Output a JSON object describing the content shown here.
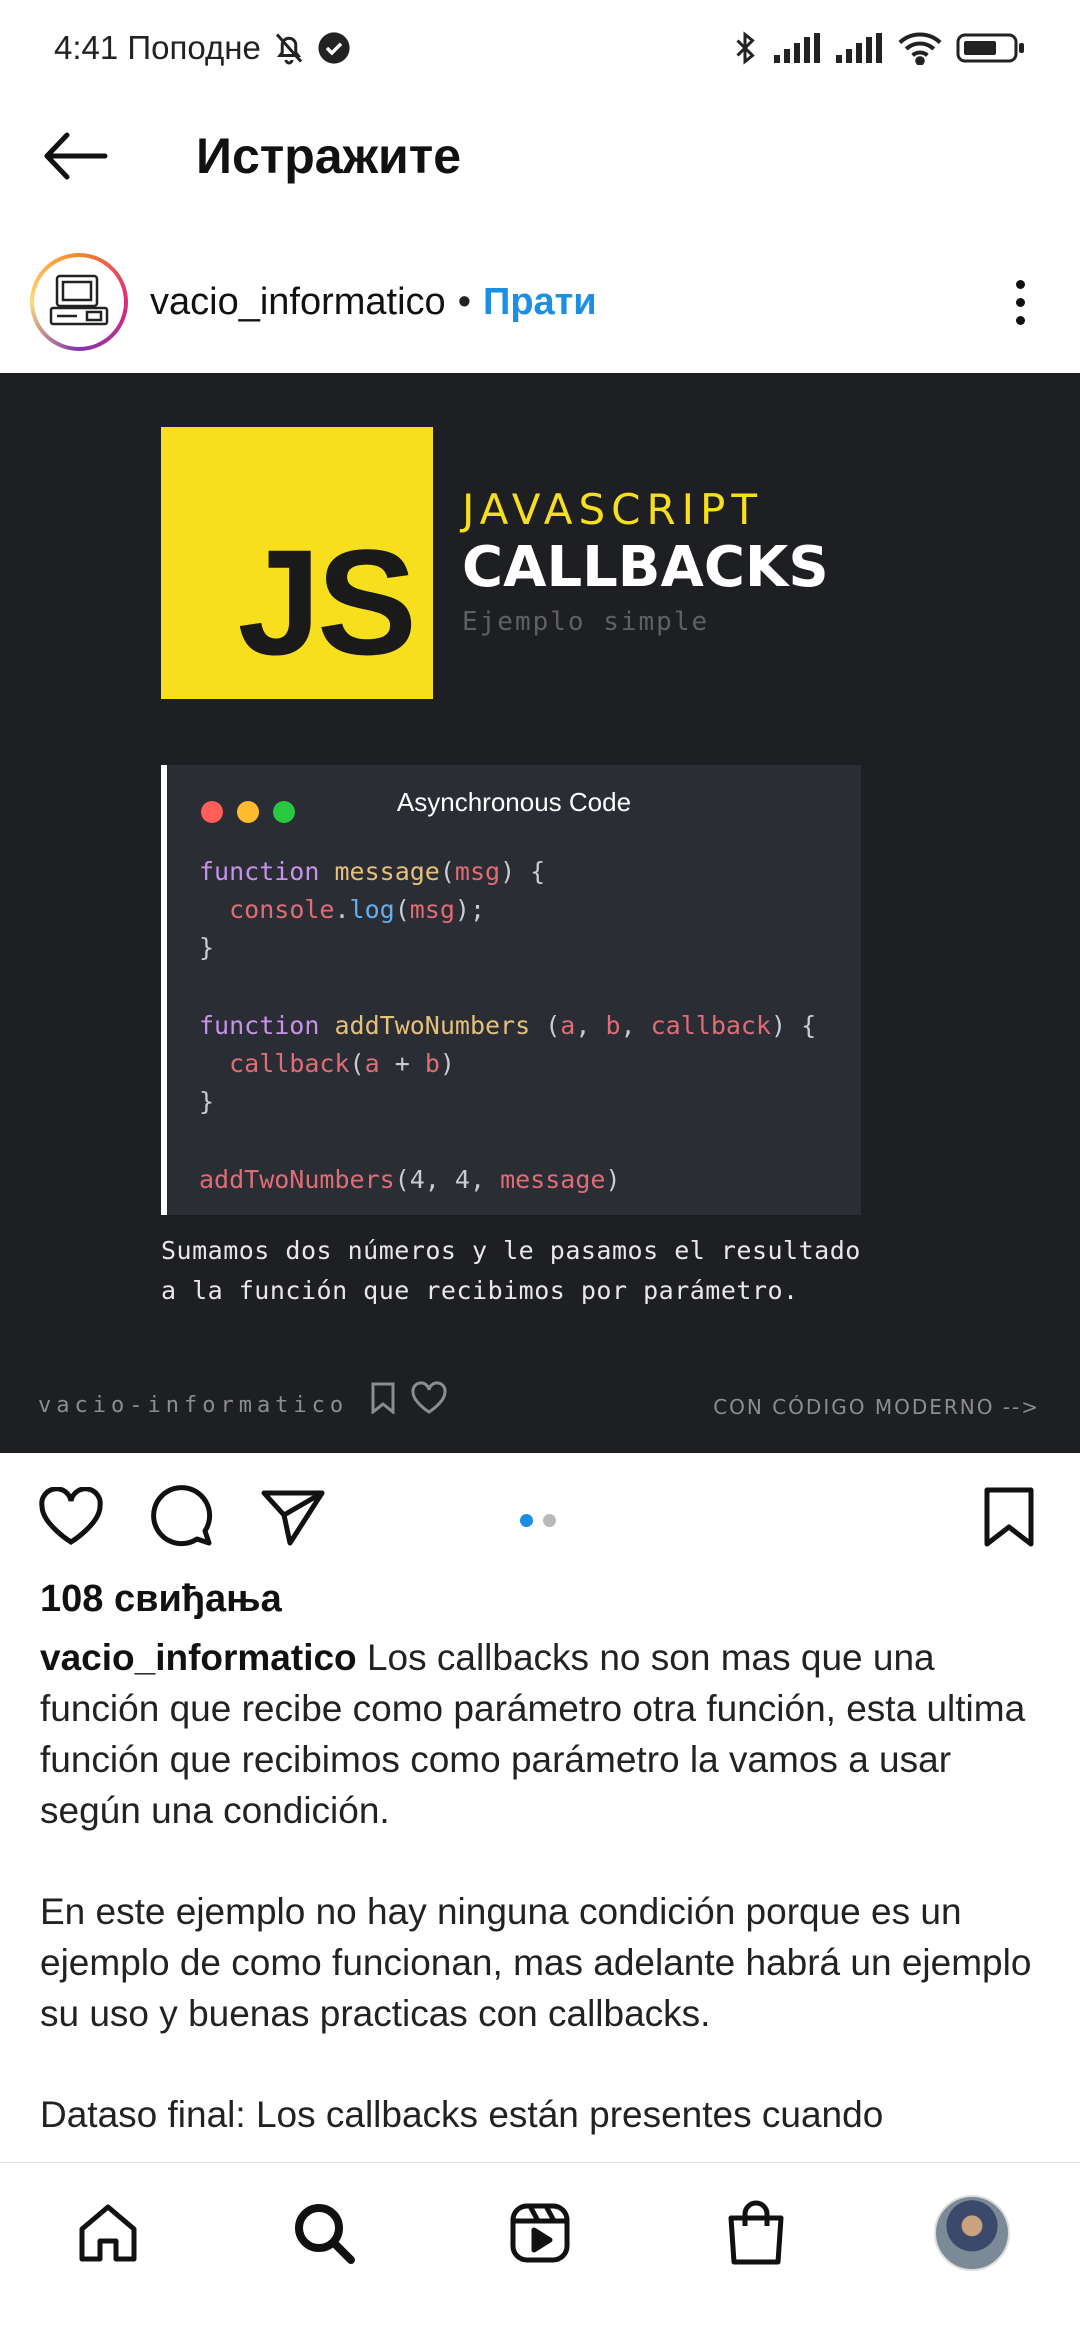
{
  "status_bar": {
    "time": "4:41 Поподне",
    "icons": [
      "mute-icon",
      "check-circle-icon",
      "bluetooth-icon",
      "signal-icon",
      "signal-icon",
      "wifi-icon",
      "battery-icon"
    ]
  },
  "header": {
    "title": "Истражите"
  },
  "post": {
    "username": "vacio_informatico",
    "separator": "•",
    "follow_label": "Прати",
    "image": {
      "logo_text": "JS",
      "title_line1": "JAVASCRIPT",
      "title_line2": "CALLBACKS",
      "title_line3": "Ejemplo simple",
      "window_title": "Asynchronous Code",
      "code_lines": [
        "function message(msg) {",
        "  console.log(msg);",
        "}",
        "",
        "function addTwoNumbers (a, b, callback) {",
        "  callback(a + b)",
        "}",
        "",
        "addTwoNumbers(4, 4, message)"
      ],
      "caption_line1": "Sumamos dos números y le pasamos el resultado",
      "caption_line2": "a la función que recibimos por parámetro.",
      "footer_left": "vacio-informatico",
      "footer_right": "CON CÓDIGO MODERNO -->"
    },
    "likes": "108 свиђања",
    "caption_user": "vacio_informatico",
    "caption_p1": "Los callbacks no son mas que una función que recibe como parámetro otra función, esta ultima función que recibimos como parámetro la vamos a usar según una condición.",
    "caption_p2": "En este ejemplo no hay ninguna condición porque es un ejemplo de como funcionan, mas adelante habrá un ejemplo su uso y buenas practicas con callbacks.",
    "caption_p3": "Dataso final: Los callbacks están presentes cuando"
  },
  "colors": {
    "accent": "#1a8fe3",
    "js_yellow": "#f7df1e",
    "image_bg": "#1e1f22",
    "code_bg": "#2a2d34"
  },
  "bottom_nav": [
    "home-icon",
    "search-icon",
    "reels-icon",
    "shop-icon",
    "profile-avatar"
  ]
}
